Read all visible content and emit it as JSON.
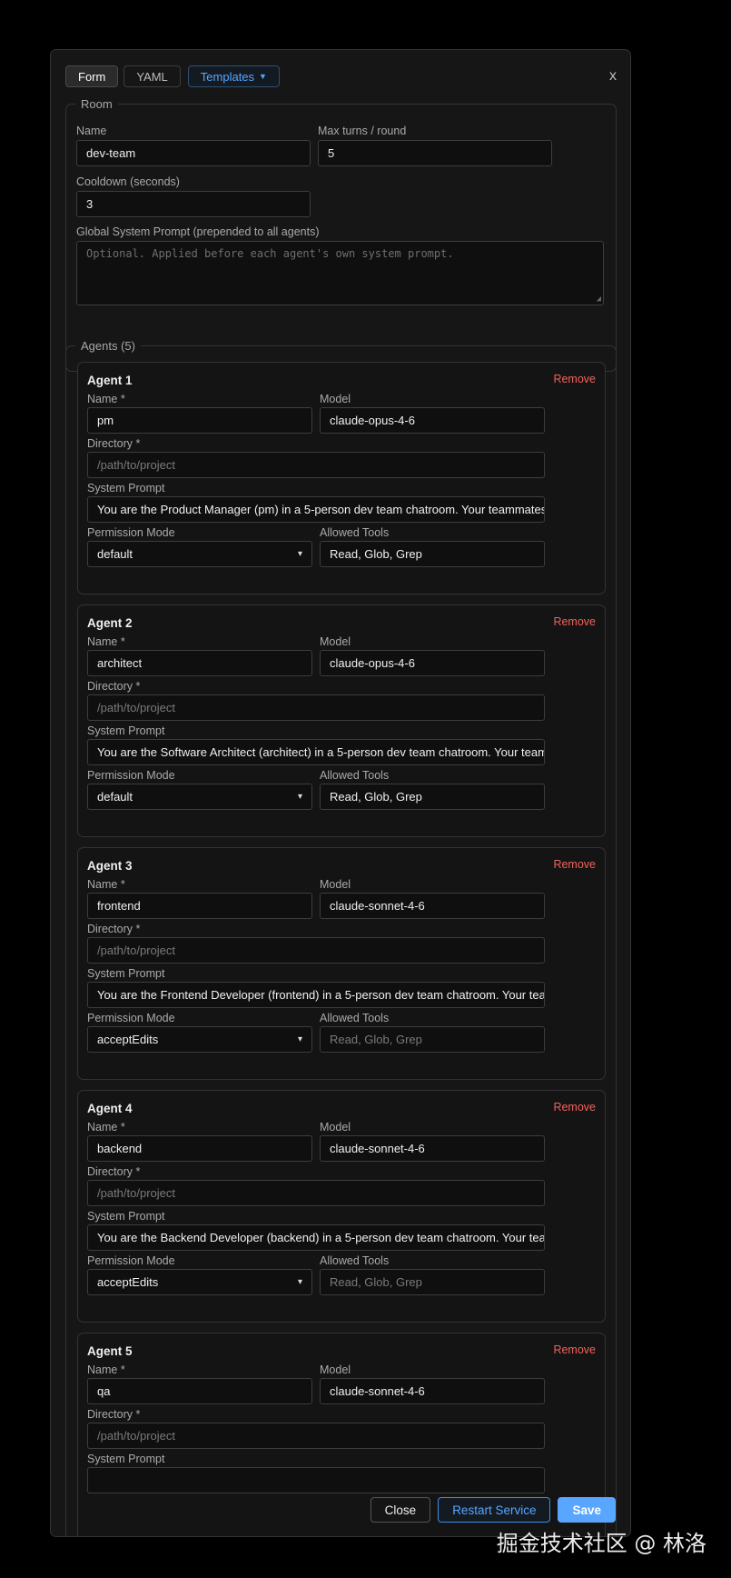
{
  "tabs": {
    "form": "Form",
    "yaml": "YAML",
    "templates": "Templates"
  },
  "close_x": "x",
  "room": {
    "legend": "Room",
    "name_label": "Name",
    "name_value": "dev-team",
    "max_turns_label": "Max turns / round",
    "max_turns_value": "5",
    "cooldown_label": "Cooldown (seconds)",
    "cooldown_value": "3",
    "global_prompt_label": "Global System Prompt (prepended to all agents)",
    "global_prompt_placeholder": "Optional. Applied before each agent's own system prompt."
  },
  "agents_legend": "Agents (5)",
  "field_labels": {
    "name": "Name *",
    "model": "Model",
    "directory": "Directory *",
    "system_prompt": "System Prompt",
    "permission_mode": "Permission Mode",
    "allowed_tools": "Allowed Tools",
    "remove": "Remove"
  },
  "agents": [
    {
      "title": "Agent 1",
      "name": "pm",
      "model": "claude-opus-4-6",
      "directory_placeholder": "/path/to/project",
      "system_prompt": "You are the Product Manager (pm) in a 5-person dev team chatroom. Your teammates: architect",
      "permission_mode": "default",
      "allowed_tools": "Read, Glob, Grep",
      "tools_is_placeholder": false
    },
    {
      "title": "Agent 2",
      "name": "architect",
      "model": "claude-opus-4-6",
      "directory_placeholder": "/path/to/project",
      "system_prompt": "You are the Software Architect (architect) in a 5-person dev team chatroom. Your teammates: pm",
      "permission_mode": "default",
      "allowed_tools": "Read, Glob, Grep",
      "tools_is_placeholder": false
    },
    {
      "title": "Agent 3",
      "name": "frontend",
      "model": "claude-sonnet-4-6",
      "directory_placeholder": "/path/to/project",
      "system_prompt": "You are the Frontend Developer (frontend) in a 5-person dev team chatroom. Your teammates:",
      "permission_mode": "acceptEdits",
      "allowed_tools": "Read, Glob, Grep",
      "tools_is_placeholder": true
    },
    {
      "title": "Agent 4",
      "name": "backend",
      "model": "claude-sonnet-4-6",
      "directory_placeholder": "/path/to/project",
      "system_prompt": "You are the Backend Developer (backend) in a 5-person dev team chatroom. Your teammates:",
      "permission_mode": "acceptEdits",
      "allowed_tools": "Read, Glob, Grep",
      "tools_is_placeholder": true
    },
    {
      "title": "Agent 5",
      "name": "qa",
      "model": "claude-sonnet-4-6",
      "directory_placeholder": "/path/to/project",
      "system_prompt": "",
      "permission_mode": "",
      "allowed_tools": "",
      "tools_is_placeholder": true
    }
  ],
  "footer": {
    "close": "Close",
    "restart": "Restart Service",
    "save": "Save"
  },
  "watermark": "掘金技术社区 @ 林洛",
  "colors": {
    "accent": "#58a6ff",
    "danger": "#f0625d",
    "panel": "#161616",
    "background": "#000000"
  },
  "icons": {
    "templates_caret": "caret-down-icon",
    "select_chevron": "chevron-down-icon",
    "resize": "resize-grip-icon"
  }
}
